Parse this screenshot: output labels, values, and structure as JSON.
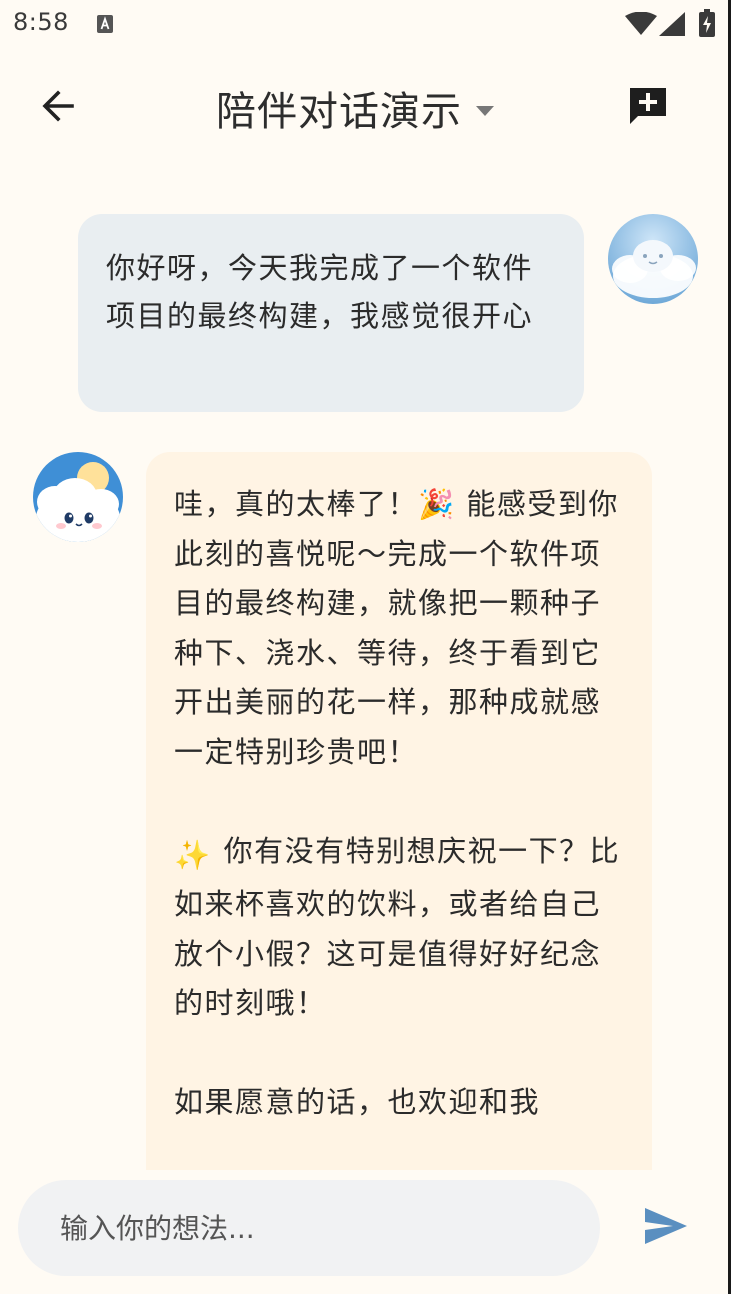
{
  "status_bar": {
    "time": "8:58",
    "icons": [
      "app-notification-icon",
      "wifi-icon",
      "cell-signal-icon",
      "battery-charging-icon"
    ]
  },
  "app_bar": {
    "title": "陪伴对话演示",
    "back_icon": "arrow-back-icon",
    "dropdown_icon": "caret-down-icon",
    "new_chat_icon": "add-comment-icon"
  },
  "messages": [
    {
      "role": "user",
      "text": "你好呀，今天我完成了一个软件项目的最终构建，我感觉很开心"
    },
    {
      "role": "assistant",
      "paragraphs": [
        {
          "emoji": "",
          "text": "哇，真的太棒了！🎉 能感受到你此刻的喜悦呢～完成一个软件项目的最终构建，就像把一颗种子种下、浇水、等待，终于看到它开出美丽的花一样，那种成就感一定特别珍贵吧！"
        },
        {
          "emoji": "✨",
          "text": "你有没有特别想庆祝一下？比如来杯喜欢的饮料，或者给自己放个小假？这可是值得好好纪念的时刻哦！"
        },
        {
          "emoji": "",
          "text": "如果愿意的话，也欢迎和我"
        }
      ]
    }
  ],
  "composer": {
    "placeholder": "输入你的想法...",
    "value": "",
    "send_icon": "send-icon"
  },
  "colors": {
    "background": "#fffbf4",
    "user_bubble": "#e9eef1",
    "assistant_bubble": "#fff4e4",
    "send_accent": "#5a8fc0",
    "input_background": "#f1f2f3"
  }
}
